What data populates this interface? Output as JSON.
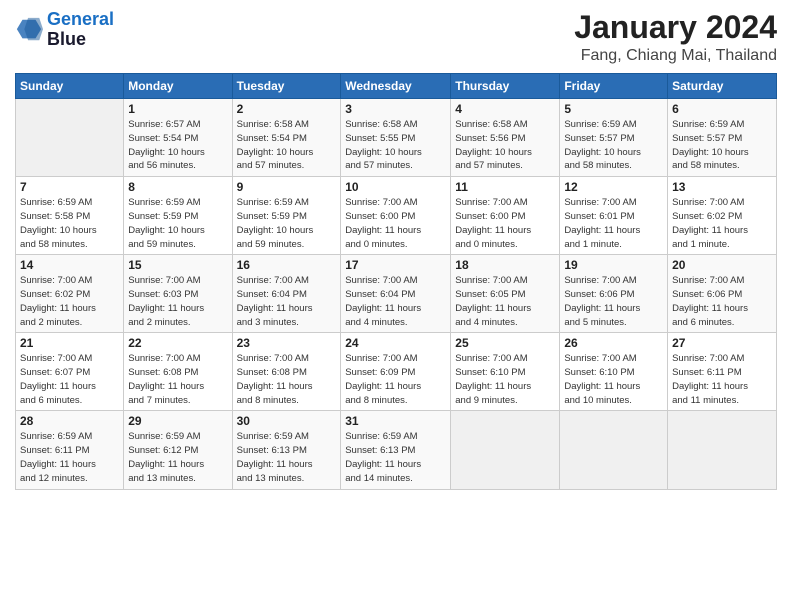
{
  "header": {
    "logo_line1": "General",
    "logo_line2": "Blue",
    "month": "January 2024",
    "location": "Fang, Chiang Mai, Thailand"
  },
  "days_of_week": [
    "Sunday",
    "Monday",
    "Tuesday",
    "Wednesday",
    "Thursday",
    "Friday",
    "Saturday"
  ],
  "weeks": [
    [
      {
        "day": "",
        "info": ""
      },
      {
        "day": "1",
        "info": "Sunrise: 6:57 AM\nSunset: 5:54 PM\nDaylight: 10 hours\nand 56 minutes."
      },
      {
        "day": "2",
        "info": "Sunrise: 6:58 AM\nSunset: 5:54 PM\nDaylight: 10 hours\nand 57 minutes."
      },
      {
        "day": "3",
        "info": "Sunrise: 6:58 AM\nSunset: 5:55 PM\nDaylight: 10 hours\nand 57 minutes."
      },
      {
        "day": "4",
        "info": "Sunrise: 6:58 AM\nSunset: 5:56 PM\nDaylight: 10 hours\nand 57 minutes."
      },
      {
        "day": "5",
        "info": "Sunrise: 6:59 AM\nSunset: 5:57 PM\nDaylight: 10 hours\nand 58 minutes."
      },
      {
        "day": "6",
        "info": "Sunrise: 6:59 AM\nSunset: 5:57 PM\nDaylight: 10 hours\nand 58 minutes."
      }
    ],
    [
      {
        "day": "7",
        "info": "Sunrise: 6:59 AM\nSunset: 5:58 PM\nDaylight: 10 hours\nand 58 minutes."
      },
      {
        "day": "8",
        "info": "Sunrise: 6:59 AM\nSunset: 5:59 PM\nDaylight: 10 hours\nand 59 minutes."
      },
      {
        "day": "9",
        "info": "Sunrise: 6:59 AM\nSunset: 5:59 PM\nDaylight: 10 hours\nand 59 minutes."
      },
      {
        "day": "10",
        "info": "Sunrise: 7:00 AM\nSunset: 6:00 PM\nDaylight: 11 hours\nand 0 minutes."
      },
      {
        "day": "11",
        "info": "Sunrise: 7:00 AM\nSunset: 6:00 PM\nDaylight: 11 hours\nand 0 minutes."
      },
      {
        "day": "12",
        "info": "Sunrise: 7:00 AM\nSunset: 6:01 PM\nDaylight: 11 hours\nand 1 minute."
      },
      {
        "day": "13",
        "info": "Sunrise: 7:00 AM\nSunset: 6:02 PM\nDaylight: 11 hours\nand 1 minute."
      }
    ],
    [
      {
        "day": "14",
        "info": "Sunrise: 7:00 AM\nSunset: 6:02 PM\nDaylight: 11 hours\nand 2 minutes."
      },
      {
        "day": "15",
        "info": "Sunrise: 7:00 AM\nSunset: 6:03 PM\nDaylight: 11 hours\nand 2 minutes."
      },
      {
        "day": "16",
        "info": "Sunrise: 7:00 AM\nSunset: 6:04 PM\nDaylight: 11 hours\nand 3 minutes."
      },
      {
        "day": "17",
        "info": "Sunrise: 7:00 AM\nSunset: 6:04 PM\nDaylight: 11 hours\nand 4 minutes."
      },
      {
        "day": "18",
        "info": "Sunrise: 7:00 AM\nSunset: 6:05 PM\nDaylight: 11 hours\nand 4 minutes."
      },
      {
        "day": "19",
        "info": "Sunrise: 7:00 AM\nSunset: 6:06 PM\nDaylight: 11 hours\nand 5 minutes."
      },
      {
        "day": "20",
        "info": "Sunrise: 7:00 AM\nSunset: 6:06 PM\nDaylight: 11 hours\nand 6 minutes."
      }
    ],
    [
      {
        "day": "21",
        "info": "Sunrise: 7:00 AM\nSunset: 6:07 PM\nDaylight: 11 hours\nand 6 minutes."
      },
      {
        "day": "22",
        "info": "Sunrise: 7:00 AM\nSunset: 6:08 PM\nDaylight: 11 hours\nand 7 minutes."
      },
      {
        "day": "23",
        "info": "Sunrise: 7:00 AM\nSunset: 6:08 PM\nDaylight: 11 hours\nand 8 minutes."
      },
      {
        "day": "24",
        "info": "Sunrise: 7:00 AM\nSunset: 6:09 PM\nDaylight: 11 hours\nand 8 minutes."
      },
      {
        "day": "25",
        "info": "Sunrise: 7:00 AM\nSunset: 6:10 PM\nDaylight: 11 hours\nand 9 minutes."
      },
      {
        "day": "26",
        "info": "Sunrise: 7:00 AM\nSunset: 6:10 PM\nDaylight: 11 hours\nand 10 minutes."
      },
      {
        "day": "27",
        "info": "Sunrise: 7:00 AM\nSunset: 6:11 PM\nDaylight: 11 hours\nand 11 minutes."
      }
    ],
    [
      {
        "day": "28",
        "info": "Sunrise: 6:59 AM\nSunset: 6:11 PM\nDaylight: 11 hours\nand 12 minutes."
      },
      {
        "day": "29",
        "info": "Sunrise: 6:59 AM\nSunset: 6:12 PM\nDaylight: 11 hours\nand 13 minutes."
      },
      {
        "day": "30",
        "info": "Sunrise: 6:59 AM\nSunset: 6:13 PM\nDaylight: 11 hours\nand 13 minutes."
      },
      {
        "day": "31",
        "info": "Sunrise: 6:59 AM\nSunset: 6:13 PM\nDaylight: 11 hours\nand 14 minutes."
      },
      {
        "day": "",
        "info": ""
      },
      {
        "day": "",
        "info": ""
      },
      {
        "day": "",
        "info": ""
      }
    ]
  ]
}
